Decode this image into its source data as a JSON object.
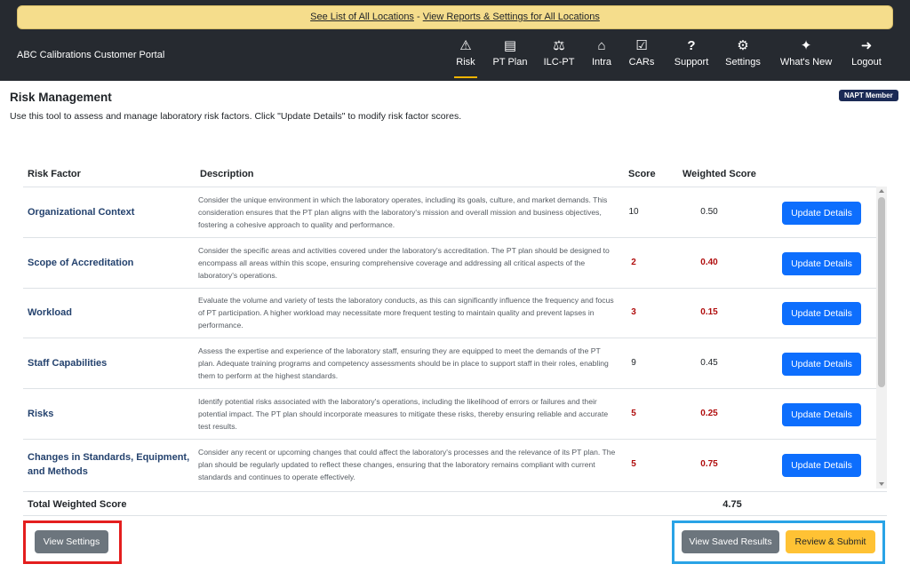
{
  "banner": {
    "link_locations": "See List of All Locations",
    "separator": " - ",
    "link_reports": "View Reports & Settings for All Locations"
  },
  "brand": "ABC Calibrations Customer Portal",
  "nav": [
    {
      "label": "Risk",
      "icon": "warning-icon",
      "glyph": "⚠",
      "active": true
    },
    {
      "label": "PT Plan",
      "icon": "document-icon",
      "glyph": "▤"
    },
    {
      "label": "ILC-PT",
      "icon": "scale-icon",
      "glyph": "⚖"
    },
    {
      "label": "Intra",
      "icon": "compass-icon",
      "glyph": "⌂"
    },
    {
      "label": "CARs",
      "icon": "checkbox-icon",
      "glyph": "☑"
    },
    {
      "label": "Support",
      "icon": "question-icon",
      "glyph": "?"
    },
    {
      "label": "Settings",
      "icon": "gears-icon",
      "glyph": "⚙"
    },
    {
      "label": "What's New",
      "icon": "sparkle-icon",
      "glyph": "✦"
    },
    {
      "label": "Logout",
      "icon": "logout-icon",
      "glyph": "➜"
    }
  ],
  "page": {
    "title": "Risk Management",
    "description": "Use this tool to assess and manage laboratory risk factors. Click \"Update Details\" to modify risk factor scores.",
    "badge": "NAPT Member"
  },
  "table": {
    "headers": {
      "risk_factor": "Risk Factor",
      "description": "Description",
      "score": "Score",
      "weighted": "Weighted Score"
    },
    "rows": [
      {
        "factor": "Organizational Context",
        "description": "Consider the unique environment in which the laboratory operates, including its goals, culture, and market demands. This consideration ensures that the PT plan aligns with the laboratory's mission and overall mission and business objectives, fostering a cohesive approach to quality and performance.",
        "score": "10",
        "weighted": "0.50",
        "flag": false,
        "button": "Update Details"
      },
      {
        "factor": "Scope of Accreditation",
        "description": "Consider the specific areas and activities covered under the laboratory's accreditation. The PT plan should be designed to encompass all areas within this scope, ensuring comprehensive coverage and addressing all critical aspects of the laboratory's operations.",
        "score": "2",
        "weighted": "0.40",
        "flag": true,
        "button": "Update Details"
      },
      {
        "factor": "Workload",
        "description": "Evaluate the volume and variety of tests the laboratory conducts, as this can significantly influence the frequency and focus of PT participation. A higher workload may necessitate more frequent testing to maintain quality and prevent lapses in performance.",
        "score": "3",
        "weighted": "0.15",
        "flag": true,
        "button": "Update Details"
      },
      {
        "factor": "Staff Capabilities",
        "description": "Assess the expertise and experience of the laboratory staff, ensuring they are equipped to meet the demands of the PT plan. Adequate training programs and competency assessments should be in place to support staff in their roles, enabling them to perform at the highest standards.",
        "score": "9",
        "weighted": "0.45",
        "flag": false,
        "button": "Update Details"
      },
      {
        "factor": "Risks",
        "description": "Identify potential risks associated with the laboratory's operations, including the likelihood of errors or failures and their potential impact. The PT plan should incorporate measures to mitigate these risks, thereby ensuring reliable and accurate test results.",
        "score": "5",
        "weighted": "0.25",
        "flag": true,
        "button": "Update Details"
      },
      {
        "factor": "Changes in Standards, Equipment, and Methods",
        "description": "Consider any recent or upcoming changes that could affect the laboratory's processes and the relevance of its PT plan. The plan should be regularly updated to reflect these changes, ensuring that the laboratory remains compliant with current standards and continues to operate effectively.",
        "score": "5",
        "weighted": "0.75",
        "flag": true,
        "button": "Update Details"
      }
    ],
    "total_label": "Total Weighted Score",
    "total_value": "4.75"
  },
  "footer": {
    "view_settings": "View Settings",
    "view_saved": "View Saved Results",
    "review_submit": "Review & Submit"
  },
  "colors": {
    "nav_bg": "#262a30",
    "banner_bg": "#f5dd8c",
    "primary": "#0d6efd",
    "danger_text": "#b00d0d",
    "accent": "#ffc234",
    "highlight_red": "#e41e1e",
    "highlight_blue": "#29a3e6"
  }
}
